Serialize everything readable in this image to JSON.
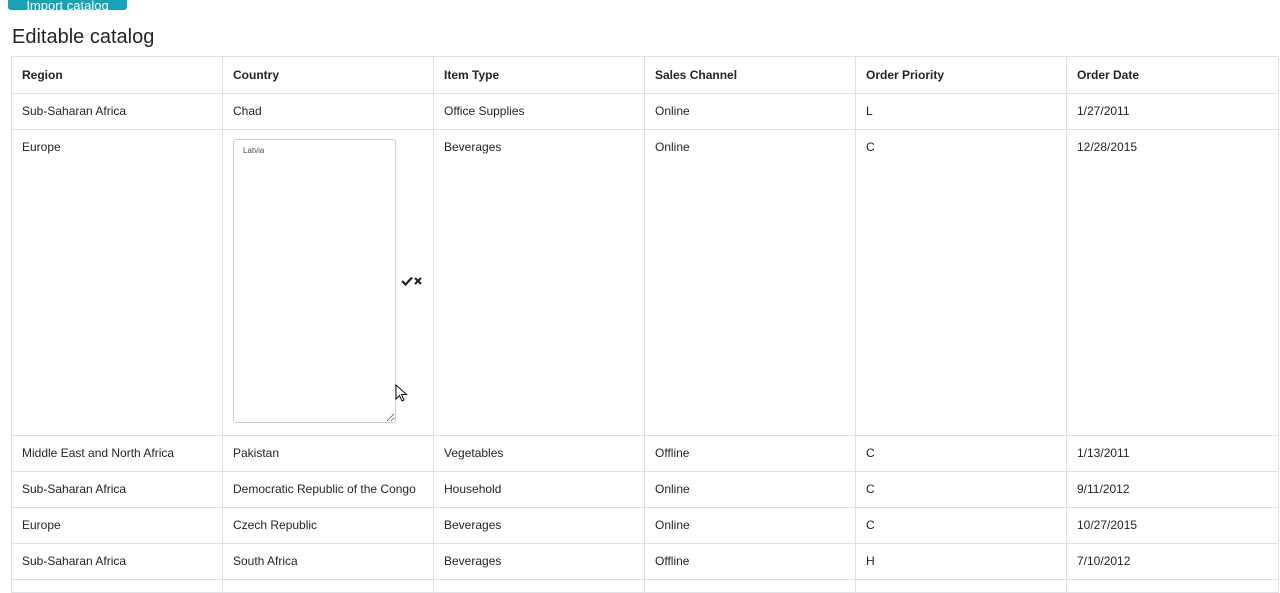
{
  "top_button": {
    "label": "Import catalog"
  },
  "page": {
    "title": "Editable catalog"
  },
  "table": {
    "headers": [
      "Region",
      "Country",
      "Item Type",
      "Sales Channel",
      "Order Priority",
      "Order Date"
    ],
    "rows": [
      [
        "Sub-Saharan Africa",
        "Chad",
        "Office Supplies",
        "Online",
        "L",
        "1/27/2011"
      ],
      [
        "Europe",
        "",
        "Beverages",
        "Online",
        "C",
        "12/28/2015"
      ],
      [
        "Middle East and North Africa",
        "Pakistan",
        "Vegetables",
        "Offline",
        "C",
        "1/13/2011"
      ],
      [
        "Sub-Saharan Africa",
        "Democratic Republic of the Congo",
        "Household",
        "Online",
        "C",
        "9/11/2012"
      ],
      [
        "Europe",
        "Czech Republic",
        "Beverages",
        "Online",
        "C",
        "10/27/2015"
      ],
      [
        "Sub-Saharan Africa",
        "South Africa",
        "Beverages",
        "Offline",
        "H",
        "7/10/2012"
      ]
    ]
  },
  "editor": {
    "value": "Latvia",
    "confirm_icon": "check-icon",
    "cancel_icon": "close-icon"
  },
  "colors": {
    "button": "#17a2b8",
    "border": "#dee2e6",
    "text": "#212529"
  }
}
